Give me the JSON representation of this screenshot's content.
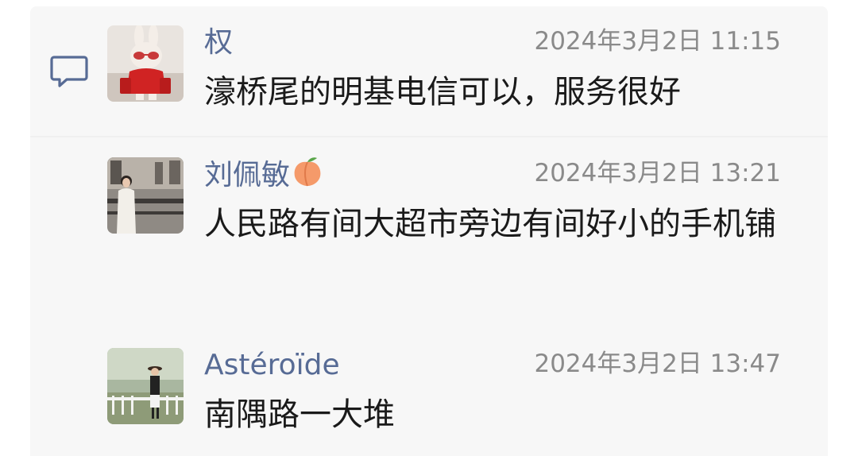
{
  "comments": [
    {
      "name": "权",
      "time": "2024年3月2日 11:15",
      "text": "濠桥尾的明基电信可以，服务很好",
      "avatar": "rabbit-figure-avatar"
    },
    {
      "name": "刘佩敏",
      "name_emoji": "peach-emoji",
      "time": "2024年3月2日 13:21",
      "text": "人民路有间大超市旁边有间好小的手机铺",
      "avatar": "woman-photo-avatar"
    },
    {
      "name": "Astéroïde",
      "time": "2024年3月2日 13:47",
      "text": "南隅路一大堆",
      "avatar": "outdoor-person-avatar"
    }
  ],
  "colors": {
    "name": "#576b95",
    "time": "#8a8a8a",
    "text": "#1a1a1a",
    "panel": "#f7f7f7",
    "icon": "#576b95"
  },
  "icons": {
    "comment": "comment-bubble-icon"
  }
}
